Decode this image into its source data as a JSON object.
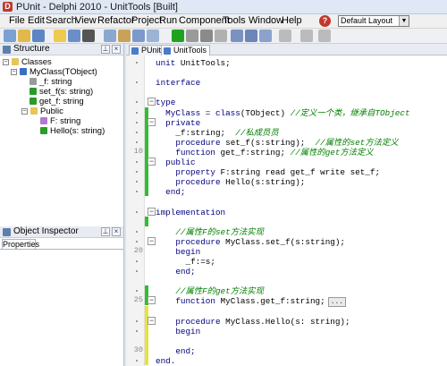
{
  "window": {
    "title": "PUnit - Delphi 2010 - UnitTools [Built]"
  },
  "menu": [
    "File",
    "Edit",
    "Search",
    "View",
    "Refactor",
    "Project",
    "Run",
    "Component",
    "Tools",
    "Window",
    "Help"
  ],
  "layout_select": {
    "value": "Default Layout"
  },
  "structure_panel": {
    "title": "Structure",
    "tree": [
      {
        "label": "Classes",
        "indent": 0,
        "icon": "folder-icon"
      },
      {
        "label": "MyClass(TObject)",
        "indent": 1,
        "icon": "class-icon"
      },
      {
        "label": "_f: string",
        "indent": 2,
        "icon": "field-icon"
      },
      {
        "label": "set_f(s: string)",
        "indent": 2,
        "icon": "method-icon"
      },
      {
        "label": "get_f: string",
        "indent": 2,
        "icon": "method-icon"
      },
      {
        "label": "Public",
        "indent": 2,
        "icon": "folder-icon"
      },
      {
        "label": "F: string",
        "indent": 3,
        "icon": "property-icon"
      },
      {
        "label": "Hello(s: string)",
        "indent": 3,
        "icon": "method-icon"
      }
    ]
  },
  "object_inspector": {
    "title": "Object Inspector",
    "tab": "Properties"
  },
  "editor": {
    "tabs": [
      {
        "label": "PUnit",
        "active": false
      },
      {
        "label": "UnitTools",
        "active": true
      }
    ],
    "line_numbers": {
      "10": "10",
      "20": "20",
      "25": "25",
      "30": "30"
    },
    "lines": [
      {
        "kw": "unit ",
        "id": "UnitTools;",
        "cm": ""
      },
      {
        "kw": "",
        "id": "",
        "cm": ""
      },
      {
        "kw": "interface",
        "id": "",
        "cm": ""
      },
      {
        "kw": "",
        "id": "",
        "cm": ""
      },
      {
        "kw": "type",
        "id": "",
        "cm": ""
      },
      {
        "kw": "  MyClass = class",
        "id": "(TObject) ",
        "cm": "//定义一个类，继承自TObject"
      },
      {
        "kw": "  private",
        "id": "",
        "cm": ""
      },
      {
        "kw": "    ",
        "id": "_f:string;  ",
        "cm": "//私成员员"
      },
      {
        "kw": "    procedure ",
        "id": "set_f(s:string);  ",
        "cm": "//属性的set方法定义"
      },
      {
        "kw": "    function ",
        "id": "get_f:string; ",
        "cm": "//属性的get方法定义"
      },
      {
        "kw": "  public",
        "id": "",
        "cm": ""
      },
      {
        "kw": "    property ",
        "id": "F:string read get_f write set_f;",
        "cm": ""
      },
      {
        "kw": "    procedure ",
        "id": "Hello(s:string);",
        "cm": ""
      },
      {
        "kw": "  end;",
        "id": "",
        "cm": ""
      },
      {
        "kw": "",
        "id": "",
        "cm": ""
      },
      {
        "kw": "implementation",
        "id": "",
        "cm": ""
      },
      {
        "kw": "",
        "id": "",
        "cm": ""
      },
      {
        "kw": "    ",
        "id": "",
        "cm": "//属性F的set方法实现"
      },
      {
        "kw": "    procedure ",
        "id": "MyClass.set_f(s:string);",
        "cm": ""
      },
      {
        "kw": "    begin",
        "id": "",
        "cm": ""
      },
      {
        "kw": "      ",
        "id": "_f:=s;",
        "cm": ""
      },
      {
        "kw": "    end;",
        "id": "",
        "cm": ""
      },
      {
        "kw": "",
        "id": "",
        "cm": ""
      },
      {
        "kw": "    ",
        "id": "",
        "cm": "//属性F的get方法实现"
      },
      {
        "kw": "    function ",
        "id": "MyClass.get_f:string;",
        "cm": "",
        "ellipsis": "..."
      },
      {
        "kw": "",
        "id": "",
        "cm": ""
      },
      {
        "kw": "    procedure ",
        "id": "MyClass.Hello(s: string);",
        "cm": ""
      },
      {
        "kw": "    begin",
        "id": "",
        "cm": ""
      },
      {
        "kw": "",
        "id": "",
        "cm": ""
      },
      {
        "kw": "    end;",
        "id": "",
        "cm": ""
      },
      {
        "kw": "end.",
        "id": "",
        "cm": ""
      }
    ]
  },
  "colors": {
    "change_saved": "#2fbf2f",
    "change_unsaved": "#e8e338",
    "keyword": "#000080",
    "comment": "#008000"
  }
}
